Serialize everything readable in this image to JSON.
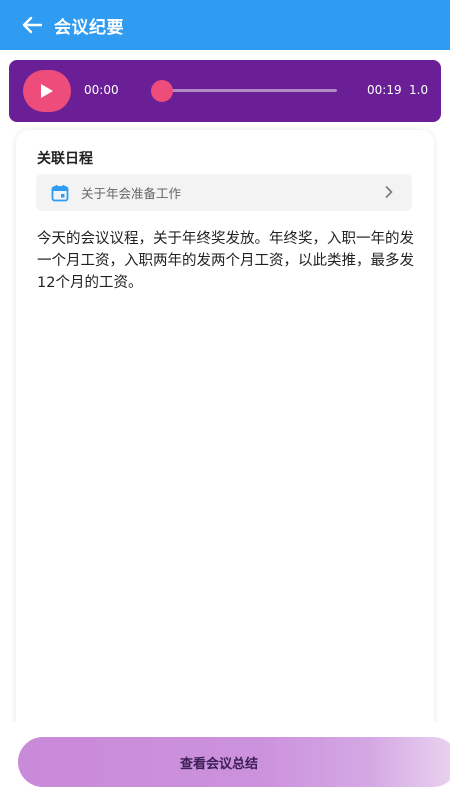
{
  "header": {
    "title": "会议纪要"
  },
  "player": {
    "current_time": "00:00",
    "total_time": "00:19",
    "speed": "1.0",
    "progress": 0
  },
  "card": {
    "section_label": "关联日程",
    "schedule_link": "关于年会准备工作",
    "content": "今天的会议议程，关于年终奖发放。年终奖，入职一年的发一个月工资，入职两年的发两个月工资，以此类推，最多发12个月的工资。"
  },
  "bottom": {
    "summary_button": "查看会议总结"
  },
  "colors": {
    "header": "#2f9cf2",
    "player": "#6b1f96",
    "accent": "#ee4d7c"
  }
}
